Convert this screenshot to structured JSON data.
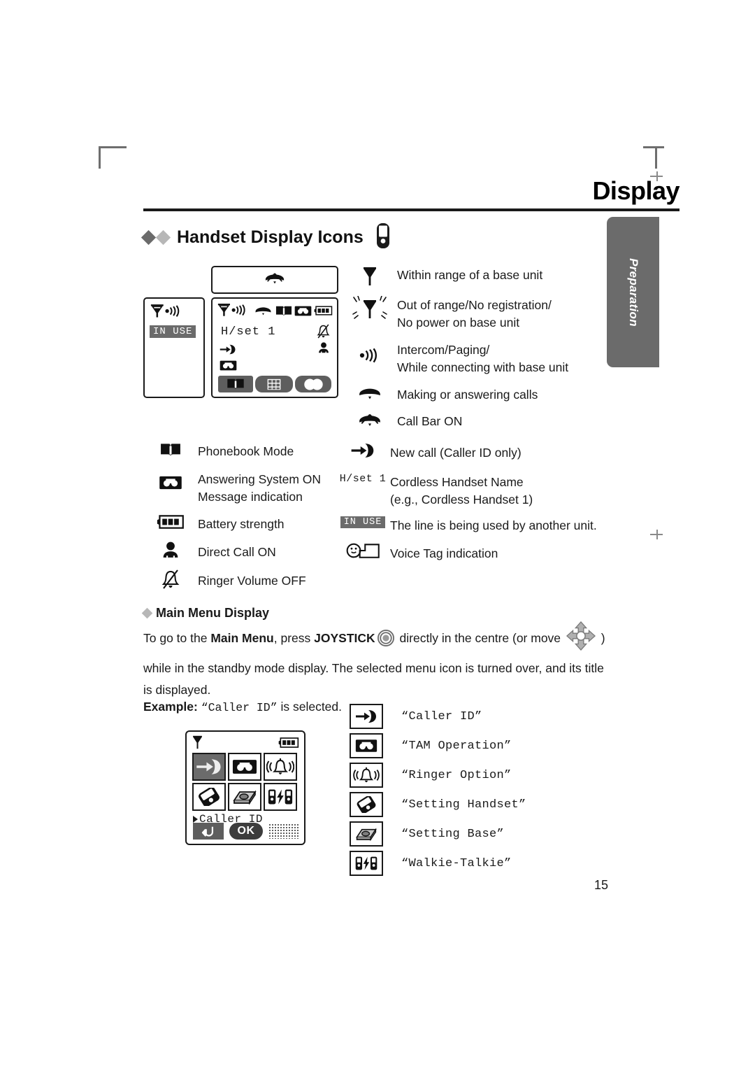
{
  "page": {
    "title": "Display",
    "number": "15",
    "side_tab": "Preparation"
  },
  "section": {
    "heading": "Handset Display Icons",
    "heading_icon": "handset-icon"
  },
  "lcd_standby": {
    "callbar_box_icon": "call-bar-on-icon",
    "left_panel": {
      "signal_icon": "antenna-intercom-icon",
      "in_use_label": "IN USE"
    },
    "main_panel": {
      "top_icons": [
        "antenna-intercom-icon",
        "handset-call-icon",
        "phonebook-icon",
        "answering-system-icon",
        "battery-icon"
      ],
      "handset_name": "H/set 1",
      "ringer_off_icon": "ringer-volume-off-icon",
      "direct_call_icon": "direct-call-on-icon",
      "new_call_icon": "new-call-icon",
      "tam_icon": "answering-system-icon",
      "softkeys": [
        "phonebook-icon",
        "menu-grid-icon",
        "two-circles-icon"
      ]
    }
  },
  "legend_right_top": [
    {
      "icon": "antenna-icon",
      "text": "Within range of a base unit"
    },
    {
      "icon": "antenna-no-signal-icon",
      "text": "Out of range/No registration/\nNo power on base unit"
    },
    {
      "icon": "intercom-waves-icon",
      "text": "Intercom/Paging/\nWhile connecting with base unit"
    },
    {
      "icon": "handset-call-icon",
      "text": "Making or answering calls"
    },
    {
      "icon": "call-bar-on-icon",
      "text": "Call Bar ON"
    }
  ],
  "legend_left": [
    {
      "icon": "phonebook-icon",
      "text": "Phonebook Mode"
    },
    {
      "icon": "answering-system-icon",
      "text": "Answering System ON\nMessage indication"
    },
    {
      "icon": "battery-icon",
      "text": "Battery strength"
    },
    {
      "icon": "direct-call-on-icon",
      "text": "Direct Call ON"
    },
    {
      "icon": "ringer-volume-off-icon",
      "text": "Ringer Volume OFF"
    }
  ],
  "legend_right_bottom": [
    {
      "icon": "new-call-icon",
      "label": "",
      "text": "New call (Caller ID only)"
    },
    {
      "icon": "handset-name-text",
      "label": "H/set 1",
      "text": "Cordless Handset Name\n(e.g., Cordless Handset 1)"
    },
    {
      "icon": "in-use-badge",
      "label": "IN USE",
      "text": "The line is being used by another unit."
    },
    {
      "icon": "voice-tag-icon",
      "label": "",
      "text": "Voice Tag indication"
    }
  ],
  "main_menu": {
    "heading": "Main Menu Display",
    "paragraph_part1": "To go to the ",
    "paragraph_bold1": "Main Menu",
    "paragraph_part2": ", press ",
    "paragraph_bold2": "JOYSTICK",
    "joystick_center_icon": "joystick-center-icon",
    "paragraph_part3": " directly in the centre (or move ",
    "joystick_move_icon": "joystick-move-icon",
    "paragraph_part4": " ) while in the standby mode display. The selected menu icon is turned over, and its title is displayed.",
    "example_prefix": "Example:",
    "example_quoted": "“Caller ID”",
    "example_suffix": " is selected."
  },
  "menu_lcd": {
    "signal_icon": "antenna-icon",
    "battery_icon": "battery-icon",
    "cells": [
      {
        "icon": "new-call-icon",
        "selected": true
      },
      {
        "icon": "answering-system-icon",
        "selected": false
      },
      {
        "icon": "ringer-option-icon",
        "selected": false
      },
      {
        "icon": "setting-handset-icon",
        "selected": false
      },
      {
        "icon": "setting-base-icon",
        "selected": false
      },
      {
        "icon": "walkie-talkie-icon",
        "selected": false
      }
    ],
    "selected_label": "Caller ID",
    "softkey_back": "back-icon",
    "softkey_ok": "OK",
    "softkey_dots": "dot-pattern"
  },
  "menu_items": [
    {
      "icon": "new-call-icon",
      "label": "“Caller ID”"
    },
    {
      "icon": "answering-system-icon",
      "label": "“TAM Operation”"
    },
    {
      "icon": "ringer-option-icon",
      "label": "“Ringer Option”"
    },
    {
      "icon": "setting-handset-icon",
      "label": "“Setting Handset”"
    },
    {
      "icon": "setting-base-icon",
      "label": "“Setting Base”"
    },
    {
      "icon": "walkie-talkie-icon",
      "label": "“Walkie-Talkie”"
    }
  ],
  "colors": {
    "ink": "#1a1a1a",
    "tab_gray": "#6b6b6b",
    "lcd_gray": "#5e5e5e"
  }
}
